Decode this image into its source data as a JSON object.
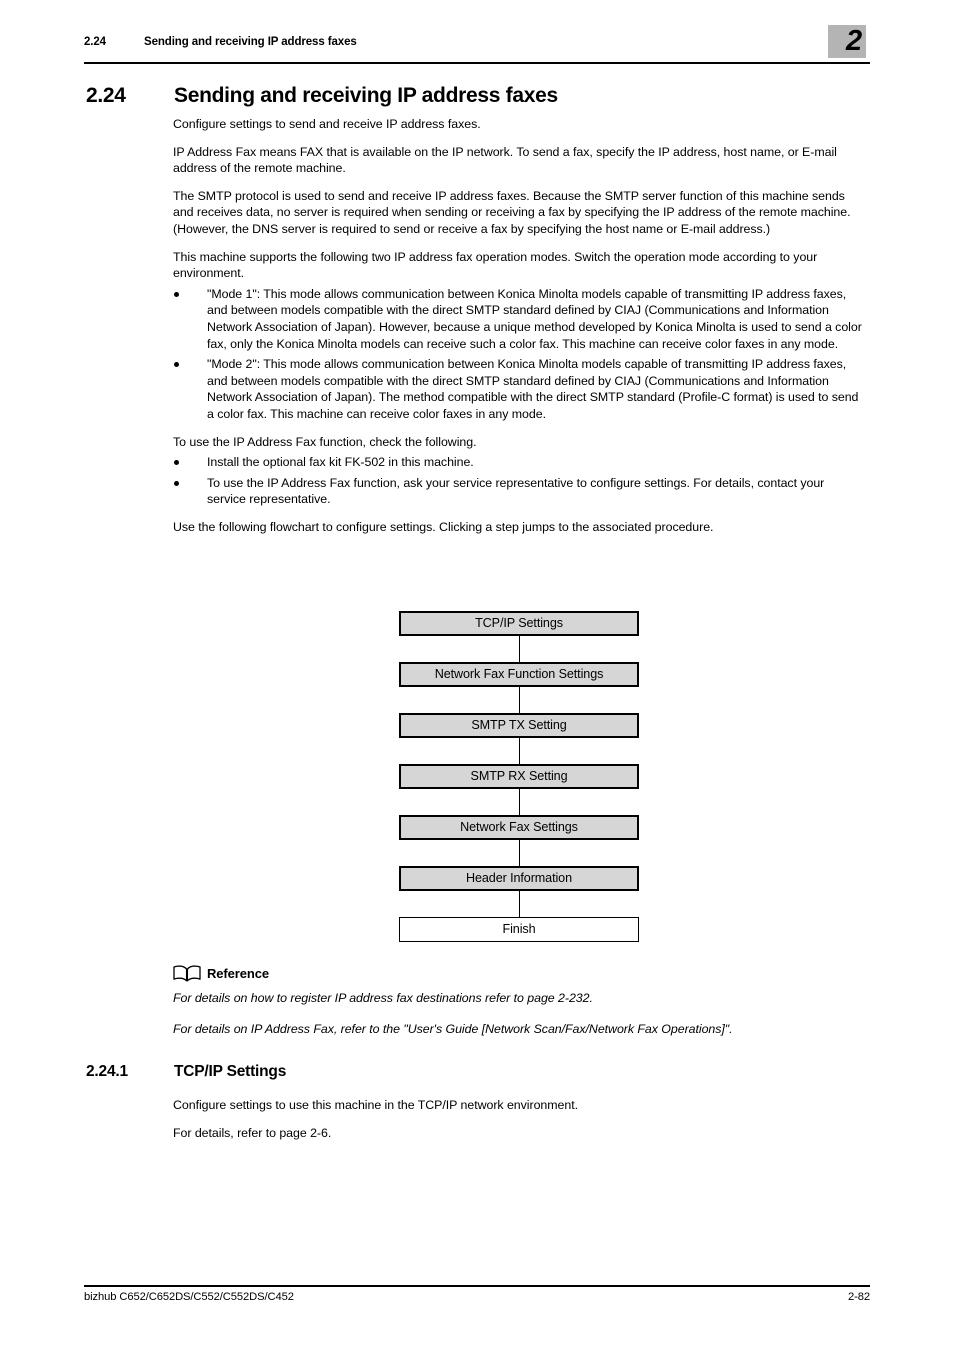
{
  "header": {
    "section_number": "2.24",
    "section_title": "Sending and receiving IP address faxes",
    "chapter_number": "2",
    "chapter_box_color": "#b4b4b4"
  },
  "heading": {
    "number": "2.24",
    "title": "Sending and receiving IP address faxes"
  },
  "body": {
    "p1": "Configure settings to send and receive IP address faxes.",
    "p2": "IP Address Fax means FAX that is available on the IP network. To send a fax, specify the IP address, host name, or E-mail address of the remote machine.",
    "p3": "The SMTP protocol is used to send and receive IP address faxes. Because the SMTP server function of this machine sends and receives data, no server is required when sending or receiving a fax by specifying the IP address of the remote machine. (However, the DNS server is required to send or receive a fax by specifying the host name or E-mail address.)",
    "p4": "This machine supports the following two IP address fax operation modes. Switch the operation mode according to your environment.",
    "modes": [
      "\"Mode 1\": This mode allows communication between Konica Minolta models capable of transmitting IP address faxes, and between models compatible with the direct SMTP standard defined by CIAJ (Communications and Information Network Association of Japan). However, because a unique method developed by Konica Minolta is used to send a color fax, only the Konica Minolta models can receive such a color fax. This machine can receive color faxes in any mode.",
      "\"Mode 2\": This mode allows communication between Konica Minolta models capable of transmitting IP address faxes, and between models compatible with the direct SMTP standard defined by CIAJ (Communications and Information Network Association of Japan). The method compatible with the direct SMTP standard (Profile-C format) is used to send a color fax. This machine can receive color faxes in any mode."
    ],
    "p5": "To use the IP Address Fax function, check the following.",
    "requirements": [
      "Install the optional fax kit FK-502 in this machine.",
      "To use the IP Address Fax function, ask your service representative to configure settings. For details, contact your service representative."
    ],
    "p6": "Use the following flowchart to configure settings. Clicking a step jumps to the associated procedure."
  },
  "flowchart": {
    "box_fill": "#d6d6d6",
    "steps": [
      {
        "label": "TCP/IP Settings",
        "terminal": false
      },
      {
        "label": "Network Fax Function Settings",
        "terminal": false
      },
      {
        "label": "SMTP TX Setting",
        "terminal": false
      },
      {
        "label": "SMTP RX Setting",
        "terminal": false
      },
      {
        "label": "Network Fax Settings",
        "terminal": false
      },
      {
        "label": "Header Information",
        "terminal": false
      },
      {
        "label": "Finish",
        "terminal": true
      }
    ]
  },
  "reference": {
    "icon": "open-book-icon",
    "title": "Reference",
    "line1": "For details on how to register IP address fax destinations refer to page 2-232.",
    "line2": "For details on IP Address Fax, refer to the \"User's Guide [Network Scan/Fax/Network Fax Operations]\"."
  },
  "subsection": {
    "number": "2.24.1",
    "title": "TCP/IP Settings",
    "p1": "Configure settings to use this machine in the TCP/IP network environment.",
    "p2": "For details, refer to page 2-6."
  },
  "footer": {
    "product": "bizhub C652/C652DS/C552/C552DS/C452",
    "page": "2-82"
  }
}
